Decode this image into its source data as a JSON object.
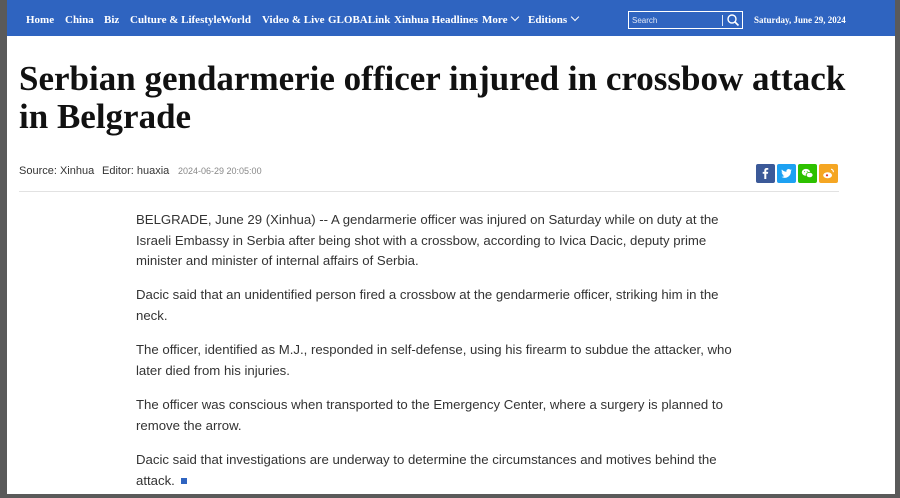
{
  "nav": {
    "items": [
      {
        "label": "Home"
      },
      {
        "label": "China"
      },
      {
        "label": "Biz"
      },
      {
        "label": "Culture & Lifestyle"
      },
      {
        "label": "World"
      },
      {
        "label": "Video & Live"
      },
      {
        "label": "GLOBALink"
      },
      {
        "label": "Xinhua Headlines"
      },
      {
        "label": "More"
      },
      {
        "label": "Editions"
      }
    ],
    "search_placeholder": "Search",
    "date": "Saturday, June 29, 2024"
  },
  "article": {
    "title": "Serbian gendarmerie officer injured in crossbow attack in Belgrade",
    "source": "Source: Xinhua",
    "editor": "Editor: huaxia",
    "time": "2024-06-29 20:05:00",
    "paragraphs": [
      "BELGRADE, June 29 (Xinhua) -- A gendarmerie officer was injured on Saturday while on duty at the Israeli Embassy in Serbia after being shot with a crossbow, according to Ivica Dacic, deputy prime minister and minister of internal affairs of Serbia.",
      "Dacic said that an unidentified person fired a crossbow at the gendarmerie officer, striking him in the neck.",
      "The officer, identified as M.J., responded in self-defense, using his firearm to subdue the attacker, who later died from his injuries.",
      "The officer was conscious when transported to the Emergency Center, where a surgery is planned to remove the arrow.",
      "Dacic said that investigations are underway to determine the circumstances and motives behind the attack."
    ]
  },
  "share": [
    {
      "icon": "facebook-icon",
      "color": "#3b5998"
    },
    {
      "icon": "twitter-icon",
      "color": "#1da1f2"
    },
    {
      "icon": "wechat-icon",
      "color": "#2dc100"
    },
    {
      "icon": "weibo-icon",
      "color": "#f5a623"
    }
  ],
  "colors": {
    "nav_bg": "#2f64c0",
    "end_mark": "#2f64c0"
  }
}
